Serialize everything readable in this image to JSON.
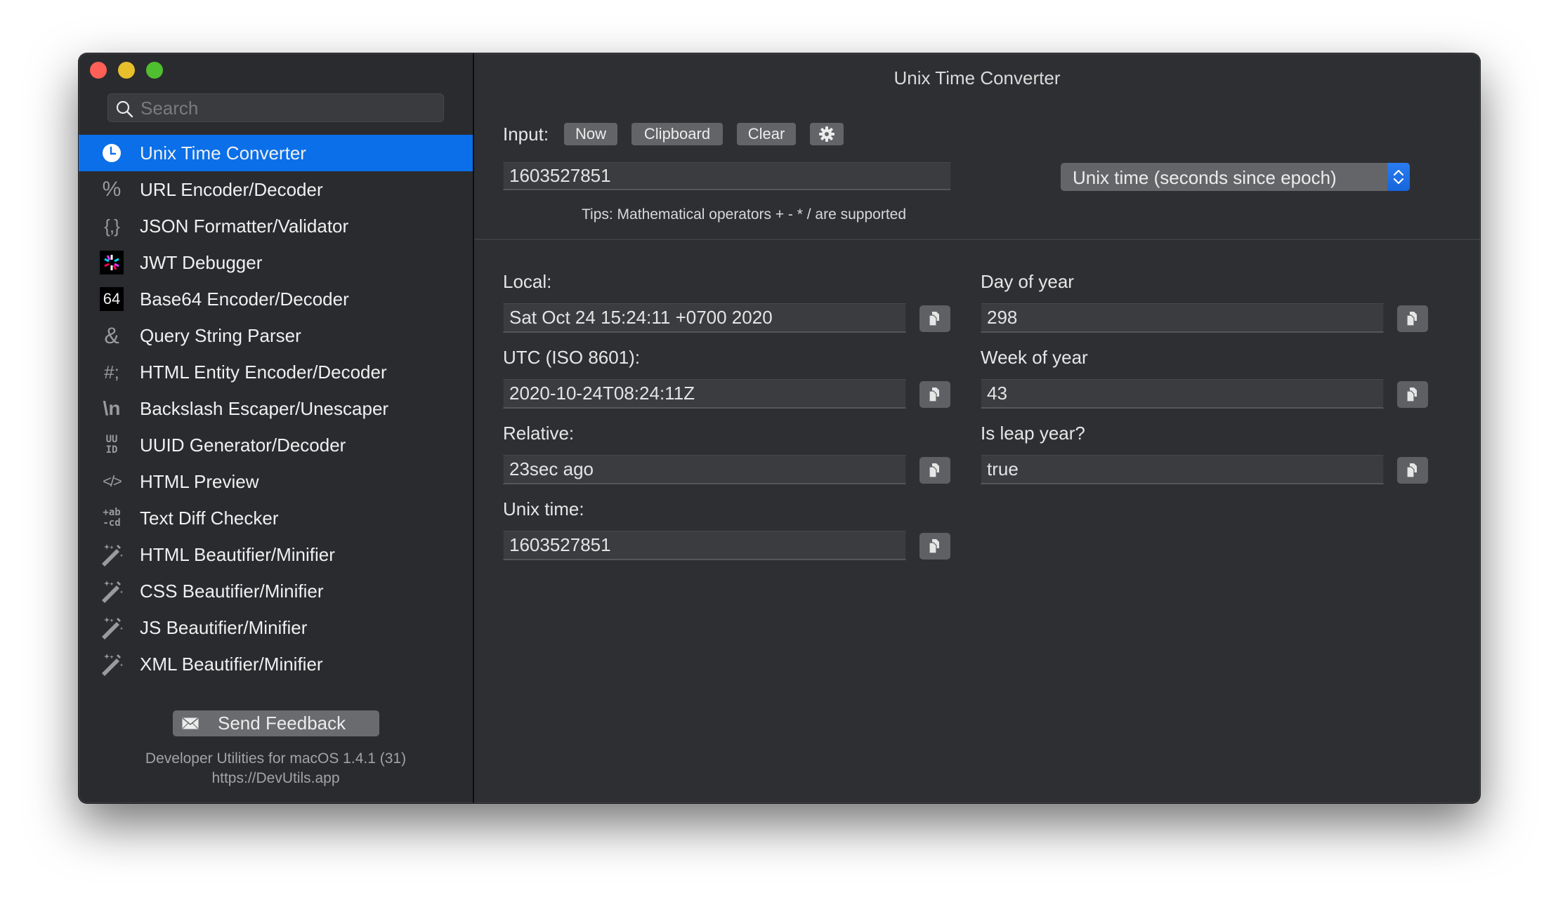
{
  "window": {
    "title": "Unix Time Converter"
  },
  "sidebar": {
    "search_placeholder": "Search",
    "items": [
      {
        "label": "Unix Time Converter",
        "icon": "clock-icon",
        "active": true
      },
      {
        "label": "URL Encoder/Decoder",
        "icon": "percent-icon",
        "glyph": "%"
      },
      {
        "label": "JSON Formatter/Validator",
        "icon": "braces-icon",
        "glyph": "{,}"
      },
      {
        "label": "JWT Debugger",
        "icon": "jwt-logo-icon"
      },
      {
        "label": "Base64 Encoder/Decoder",
        "icon": "base64-icon",
        "glyph": "64"
      },
      {
        "label": "Query String Parser",
        "icon": "ampersand-icon",
        "glyph": "&"
      },
      {
        "label": "HTML Entity Encoder/Decoder",
        "icon": "hash-semicolon-icon",
        "glyph": "#;"
      },
      {
        "label": "Backslash Escaper/Unescaper",
        "icon": "backslash-n-icon",
        "glyph": "\\n"
      },
      {
        "label": "UUID Generator/Decoder",
        "icon": "uuid-icon",
        "glyph": "UU ID"
      },
      {
        "label": "HTML Preview",
        "icon": "code-tag-icon",
        "glyph": "</>"
      },
      {
        "label": "Text Diff Checker",
        "icon": "text-diff-icon",
        "glyph": "+ab -cd"
      },
      {
        "label": "HTML Beautifier/Minifier",
        "icon": "magic-wand-icon"
      },
      {
        "label": "CSS Beautifier/Minifier",
        "icon": "magic-wand-icon"
      },
      {
        "label": "JS Beautifier/Minifier",
        "icon": "magic-wand-icon"
      },
      {
        "label": "XML Beautifier/Minifier",
        "icon": "magic-wand-icon"
      }
    ],
    "feedback_button": "Send Feedback",
    "footer_version": "Developer Utilities for macOS 1.4.1 (31)",
    "footer_url": "https://DevUtils.app"
  },
  "main": {
    "title": "Unix Time Converter",
    "input_label": "Input:",
    "buttons": {
      "now": "Now",
      "clipboard": "Clipboard",
      "clear": "Clear",
      "settings_icon": "gear-icon"
    },
    "input_value": "1603527851",
    "format_select": "Unix time (seconds since epoch)",
    "tips": "Tips: Mathematical operators + - * / are supported",
    "results_left": [
      {
        "label": "Local:",
        "value": "Sat Oct 24 15:24:11 +0700 2020"
      },
      {
        "label": "UTC (ISO 8601):",
        "value": "2020-10-24T08:24:11Z"
      },
      {
        "label": "Relative:",
        "value": "23sec ago"
      },
      {
        "label": "Unix time:",
        "value": "1603527851"
      }
    ],
    "results_right": [
      {
        "label": "Day of year",
        "value": "298"
      },
      {
        "label": "Week of year",
        "value": "43"
      },
      {
        "label": "Is leap year?",
        "value": "true"
      }
    ]
  },
  "colors": {
    "accent": "#0a6fe8",
    "sidebar_bg": "#2a2b2f",
    "main_bg": "#2e2f33",
    "traffic_red": "#fe5f57",
    "traffic_yellow": "#e6bf2b",
    "traffic_green": "#4fbf30"
  }
}
